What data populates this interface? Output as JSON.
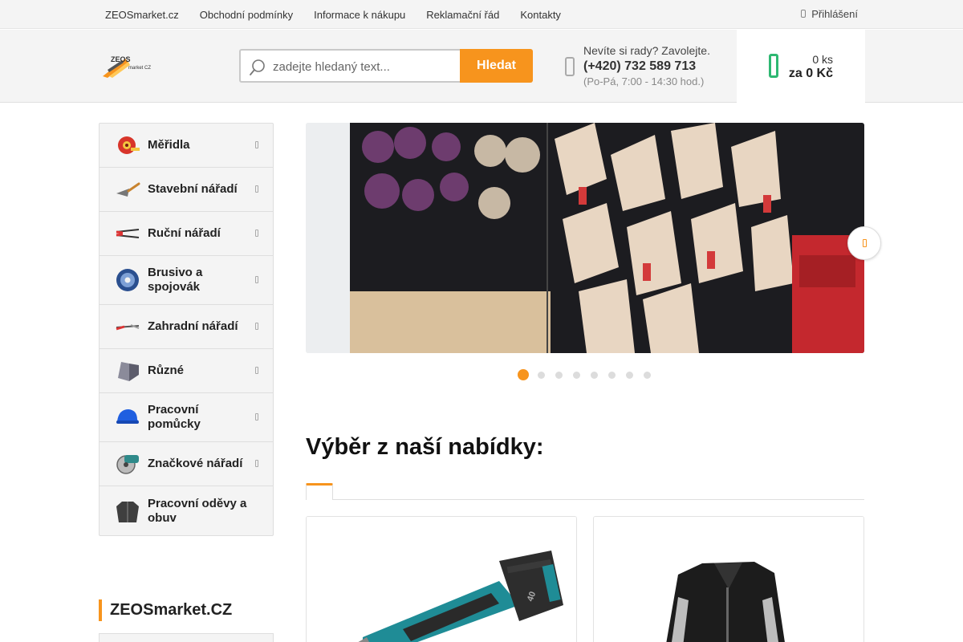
{
  "topbar": {
    "links": [
      "ZEOSmarket.cz",
      "Obchodní podmínky",
      "Informace k nákupu",
      "Reklamační řád",
      "Kontakty"
    ],
    "login_label": "Přihlášení"
  },
  "header": {
    "logo_text": "ZEOS market CZ",
    "search": {
      "placeholder": "zadejte hledaný text...",
      "button_label": "Hledat"
    },
    "contact": {
      "question": "Nevíte si rady? Zavolejte.",
      "phone": "(+420) 732 589 713",
      "hours": "(Po-Pá, 7:00 - 14:30 hod.)"
    },
    "cart": {
      "count": "0 ks",
      "total": "za 0 Kč"
    }
  },
  "sidebar": {
    "categories": [
      {
        "label": "Měřidla",
        "icon": "tape-measure-icon"
      },
      {
        "label": "Stavební nářadí",
        "icon": "trowel-icon"
      },
      {
        "label": "Ruční nářadí",
        "icon": "pliers-icon"
      },
      {
        "label": "Brusivo a spojovák",
        "icon": "grinding-disc-icon"
      },
      {
        "label": "Zahradní nářadí",
        "icon": "pruner-icon"
      },
      {
        "label": "Různé",
        "icon": "angle-bracket-icon"
      },
      {
        "label": "Pracovní pomůcky",
        "icon": "hard-hat-icon"
      },
      {
        "label": "Značkové nářadí",
        "icon": "circular-saw-icon"
      },
      {
        "label": "Pracovní oděvy a obuv",
        "icon": "work-jacket-icon"
      }
    ],
    "brand_title": "ZEOSmarket.CZ"
  },
  "banner": {
    "slide_count": 8,
    "active_slide": 1
  },
  "offer": {
    "title": "Výběr z naší nabídky:"
  },
  "colors": {
    "accent": "#f7941d",
    "cart_green": "#2eb872",
    "bar_bg": "#f4f4f4"
  }
}
